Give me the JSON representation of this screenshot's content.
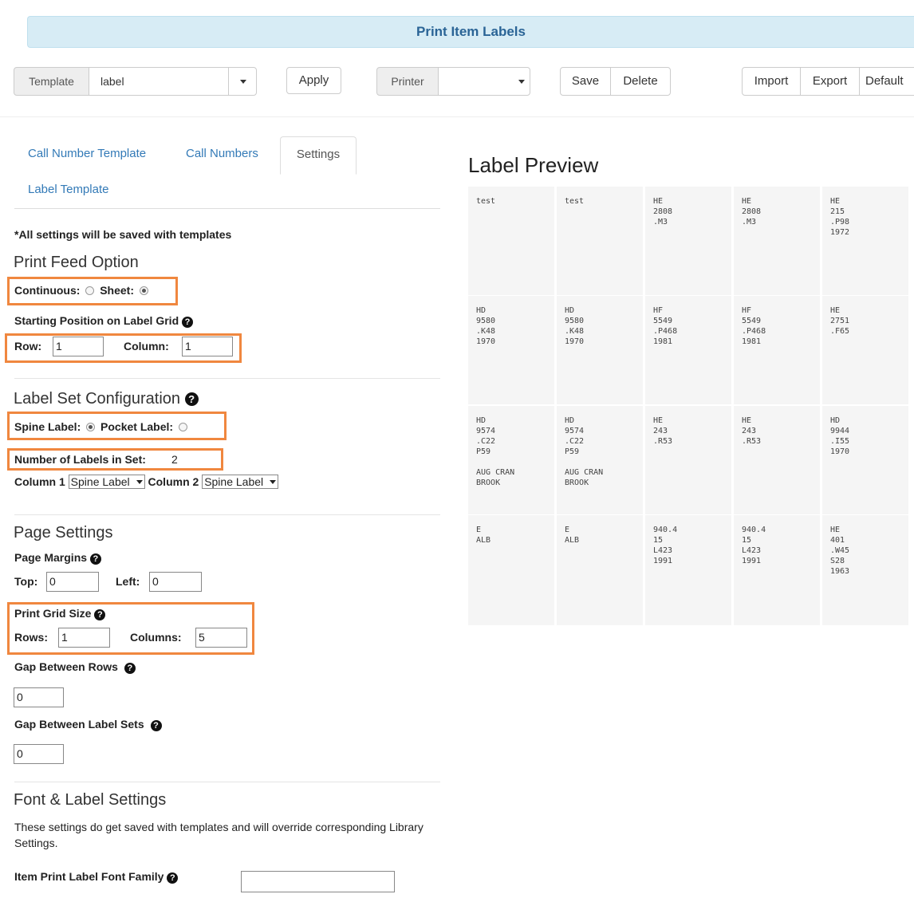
{
  "header": {
    "title": "Print Item Labels"
  },
  "toolbar": {
    "template_label": "Template",
    "template_value": "label",
    "apply_label": "Apply",
    "printer_label": "Printer",
    "printer_value": "",
    "save_label": "Save",
    "delete_label": "Delete",
    "import_label": "Import",
    "export_label": "Export",
    "default_label": "Default"
  },
  "tabs": {
    "call_number_template": "Call Number Template",
    "call_numbers": "Call Numbers",
    "settings": "Settings",
    "label_template": "Label Template",
    "active": "Settings"
  },
  "settings": {
    "note": "*All settings will be saved with templates",
    "print_feed_title": "Print Feed Option",
    "continuous_label": "Continuous:",
    "sheet_label": "Sheet:",
    "print_feed_selected": "Sheet",
    "starting_position_label": "Starting Position on Label Grid",
    "row_label": "Row:",
    "row_value": "1",
    "column_label": "Column:",
    "column_value": "1",
    "label_set_title": "Label Set Configuration",
    "spine_label": "Spine Label:",
    "pocket_label": "Pocket Label:",
    "label_set_selected": "Spine Label",
    "number_in_set_label": "Number of Labels in Set:",
    "number_in_set_value": "2",
    "column1_label": "Column 1",
    "column1_value": "Spine Label",
    "column2_label": "Column 2",
    "column2_value": "Spine Label",
    "page_settings_title": "Page Settings",
    "page_margins_label": "Page Margins",
    "top_label": "Top:",
    "top_value": "0",
    "left_label": "Left:",
    "left_value": "0",
    "print_grid_label": "Print Grid Size",
    "rows_label": "Rows:",
    "rows_value": "1",
    "columns_label": "Columns:",
    "columns_value": "5",
    "gap_rows_label": "Gap Between Rows",
    "gap_rows_value": "0",
    "gap_sets_label": "Gap Between Label Sets",
    "gap_sets_value": "0",
    "font_title": "Font & Label Settings",
    "font_note": "These settings do get saved with templates and will override corresponding Library Settings.",
    "font_family_label": "Item Print Label Font Family",
    "font_family_value": ""
  },
  "preview": {
    "title": "Label Preview",
    "rows": [
      [
        "test",
        "test",
        "HE\n2808\n.M3",
        "HE\n2808\n.M3",
        "HE\n215\n.P98\n1972"
      ],
      [
        "HD\n9580\n.K48\n1970",
        "HD\n9580\n.K48\n1970",
        "HF\n5549\n.P468\n1981",
        "HF\n5549\n.P468\n1981",
        "HE\n2751\n.F65"
      ],
      [
        "HD\n9574\n.C22\nP59\n\nAUG CRAN\nBROOK",
        "HD\n9574\n.C22\nP59\n\nAUG CRAN\nBROOK",
        "HE\n243\n.R53",
        "HE\n243\n.R53",
        "HD\n9944\n.I55\n1970"
      ],
      [
        "E\nALB",
        "E\nALB",
        "940.4\n15\nL423\n1991",
        "940.4\n15\nL423\n1991",
        "HE\n401\n.W45\nS28\n1963"
      ]
    ]
  },
  "colors": {
    "accent": "#337ab7",
    "highlight": "#f0873f",
    "header_bg": "#d7ecf5"
  }
}
